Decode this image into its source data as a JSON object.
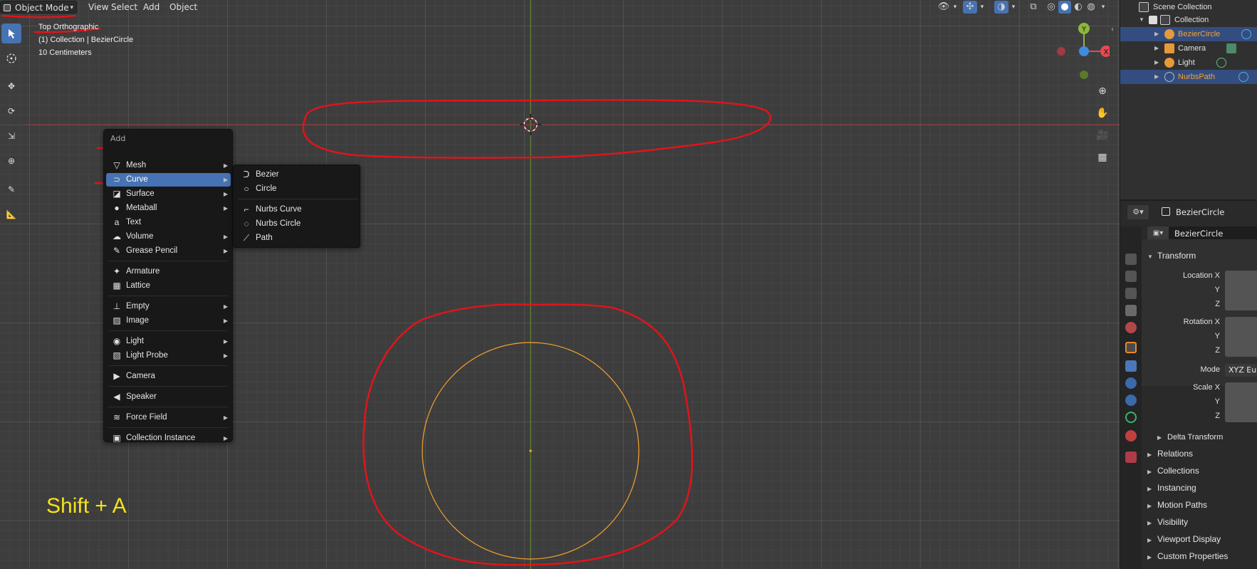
{
  "header": {
    "mode": "Object Mode",
    "menus": [
      "View",
      "Select",
      "Add",
      "Object"
    ]
  },
  "overlay": {
    "view_name": "Top Orthographic",
    "collection": "(1) Collection | BezierCircle",
    "scale": "10 Centimeters"
  },
  "gizmo": {
    "y": "Y",
    "x": "X"
  },
  "add_menu": {
    "title": "Add",
    "items": [
      {
        "label": "Mesh",
        "icon": "mesh-icon",
        "submenu": true
      },
      {
        "label": "Curve",
        "icon": "curve-icon",
        "submenu": true,
        "highlighted": true
      },
      {
        "label": "Surface",
        "icon": "surface-icon",
        "submenu": true
      },
      {
        "label": "Metaball",
        "icon": "metaball-icon",
        "submenu": true
      },
      {
        "label": "Text",
        "icon": "text-icon",
        "submenu": false
      },
      {
        "label": "Volume",
        "icon": "volume-icon",
        "submenu": true
      },
      {
        "label": "Grease Pencil",
        "icon": "grease-pencil-icon",
        "submenu": true
      },
      {
        "label": "Armature",
        "icon": "armature-icon",
        "submenu": false
      },
      {
        "label": "Lattice",
        "icon": "lattice-icon",
        "submenu": false
      },
      {
        "label": "Empty",
        "icon": "empty-icon",
        "submenu": true
      },
      {
        "label": "Image",
        "icon": "image-icon",
        "submenu": true
      },
      {
        "label": "Light",
        "icon": "light-icon",
        "submenu": true
      },
      {
        "label": "Light Probe",
        "icon": "light-probe-icon",
        "submenu": true
      },
      {
        "label": "Camera",
        "icon": "camera-icon",
        "submenu": false
      },
      {
        "label": "Speaker",
        "icon": "speaker-icon",
        "submenu": false
      },
      {
        "label": "Force Field",
        "icon": "force-field-icon",
        "submenu": true
      },
      {
        "label": "Collection Instance",
        "icon": "collection-instance-icon",
        "submenu": true
      }
    ]
  },
  "curve_submenu": {
    "items": [
      "Bezier",
      "Circle",
      "Nurbs Curve",
      "Nurbs Circle",
      "Path"
    ]
  },
  "shortcut_hint": "Shift + A",
  "outliner": {
    "scene": "Scene Collection",
    "collection": "Collection",
    "objects": [
      "BezierCircle",
      "Camera",
      "Light",
      "NurbsPath"
    ]
  },
  "properties": {
    "object_name": "BezierCircle",
    "data_name": "BezierCircle",
    "transform": "Transform",
    "location_x": "Location X",
    "rotation_x": "Rotation X",
    "scale_x": "Scale X",
    "y": "Y",
    "z": "Z",
    "mode_label": "Mode",
    "mode_value": "XYZ Eul",
    "delta": "Delta Transform",
    "sections": [
      "Relations",
      "Collections",
      "Instancing",
      "Motion Paths",
      "Visibility",
      "Viewport Display",
      "Custom Properties"
    ]
  },
  "colors": {
    "accent": "#4772b3",
    "selection_orange": "#f7a22d",
    "annotation_red": "#e0141a",
    "hint_yellow": "#f5e11a"
  }
}
